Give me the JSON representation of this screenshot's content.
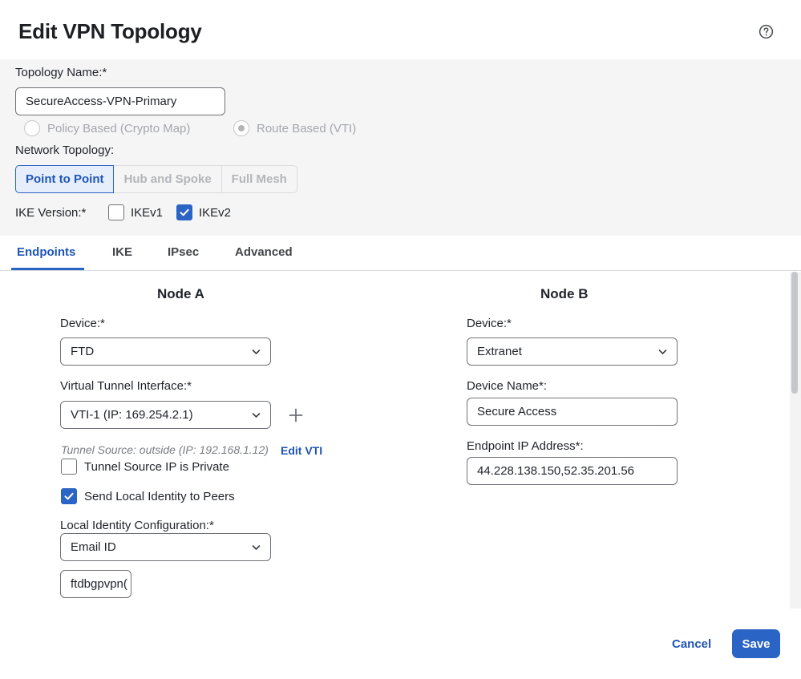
{
  "dialog": {
    "title": "Edit VPN Topology",
    "help_icon": "help-circle-icon"
  },
  "topology": {
    "name_label": "Topology Name:*",
    "name_value": "SecureAccess-VPN-Primary",
    "type_options": [
      {
        "label": "Policy Based (Crypto Map)",
        "selected": false
      },
      {
        "label": "Route Based (VTI)",
        "selected": true
      }
    ],
    "network_label": "Network Topology:",
    "network_options": [
      {
        "label": "Point to Point",
        "active": true
      },
      {
        "label": "Hub and Spoke",
        "active": false
      },
      {
        "label": "Full Mesh",
        "active": false
      }
    ],
    "ike_label": "IKE Version:*",
    "ike_options": [
      {
        "label": "IKEv1",
        "checked": false
      },
      {
        "label": "IKEv2",
        "checked": true
      }
    ]
  },
  "tabs": [
    {
      "label": "Endpoints",
      "active": true
    },
    {
      "label": "IKE",
      "active": false
    },
    {
      "label": "IPsec",
      "active": false
    },
    {
      "label": "Advanced",
      "active": false
    }
  ],
  "node_a": {
    "heading": "Node A",
    "device_label": "Device:*",
    "device_value": "FTD",
    "vti_label": "Virtual Tunnel Interface:*",
    "vti_value": "VTI-1 (IP: 169.254.2.1)",
    "tunnel_source_note": "Tunnel Source: outside (IP: 192.168.1.12)",
    "edit_vti_link": "Edit VTI",
    "tunnel_private_label": "Tunnel Source IP is Private",
    "tunnel_private_checked": false,
    "send_identity_label": "Send Local Identity to Peers",
    "send_identity_checked": true,
    "local_identity_label": "Local Identity Configuration:*",
    "local_identity_value": "Email ID",
    "email_value": "ftdbgpvpn("
  },
  "node_b": {
    "heading": "Node B",
    "device_label": "Device:*",
    "device_value": "Extranet",
    "device_name_label": "Device Name*:",
    "device_name_value": "Secure Access",
    "endpoint_ip_label": "Endpoint IP Address*:",
    "endpoint_ip_value": "44.228.138.150,52.35.201.56"
  },
  "footer": {
    "cancel_label": "Cancel",
    "save_label": "Save"
  },
  "colors": {
    "accent": "#2a64c4",
    "panel_bg": "#f5f5f6"
  }
}
